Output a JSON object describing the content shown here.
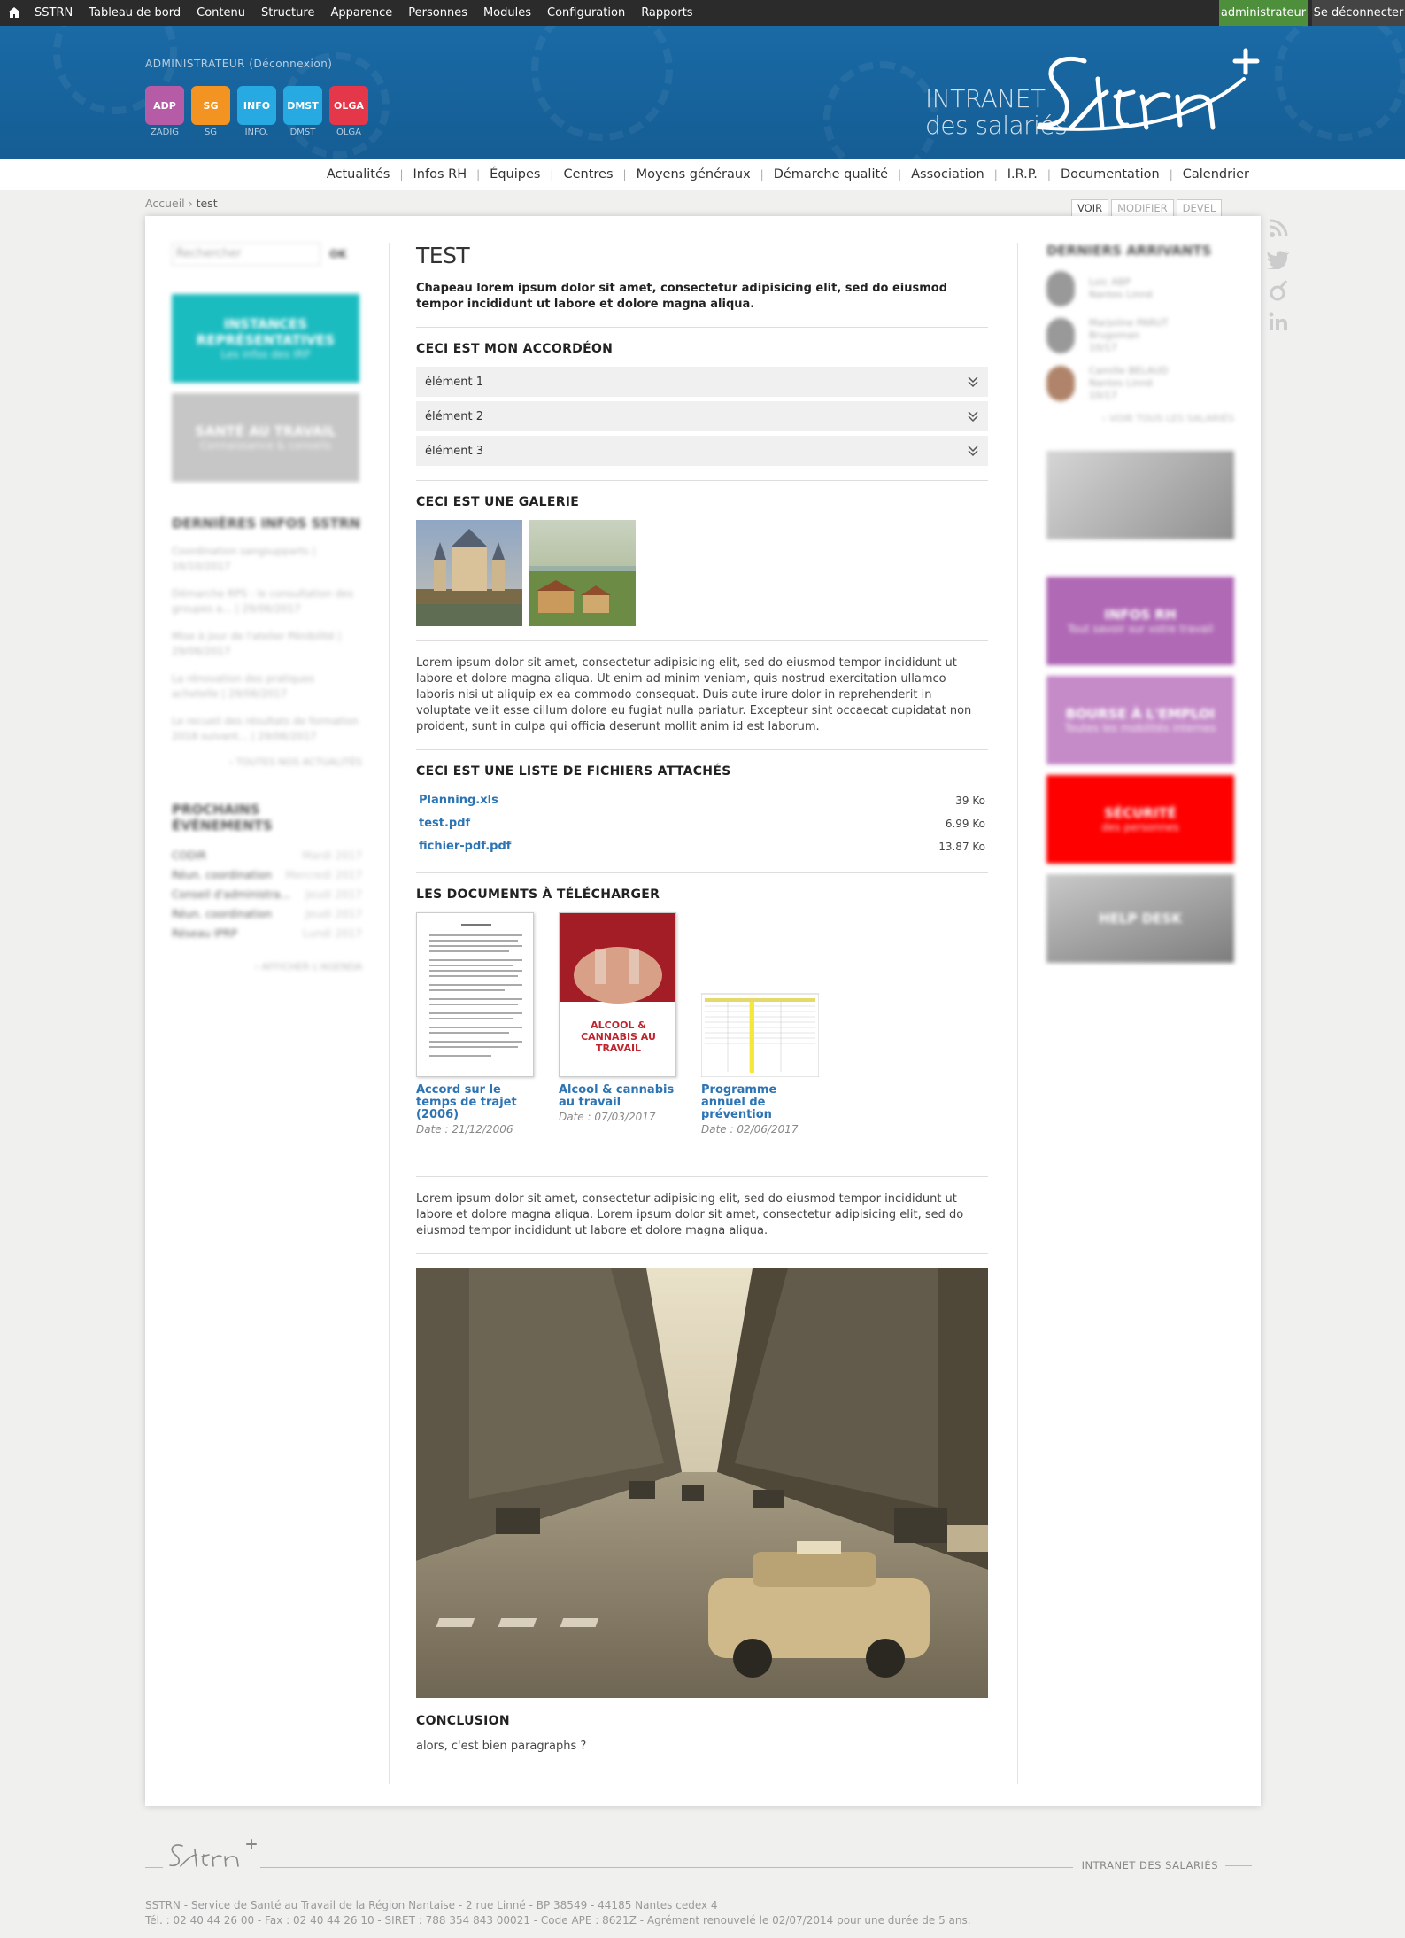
{
  "toolbar": {
    "menu": [
      "SSTRN",
      "Tableau de bord",
      "Contenu",
      "Structure",
      "Apparence",
      "Personnes",
      "Modules",
      "Configuration",
      "Rapports"
    ],
    "user": "administrateur",
    "logout": "Se déconnecter"
  },
  "banner": {
    "admin_label": "ADMINISTRATEUR",
    "admin_link": "(Déconnexion)",
    "apps": [
      {
        "label": "ZADIG",
        "tile": "ADP",
        "color": "#b65ca6"
      },
      {
        "label": "SG",
        "tile": "SG",
        "color": "#f39321"
      },
      {
        "label": "INFO.",
        "tile": "INFO",
        "color": "#27a9e1"
      },
      {
        "label": "DMST",
        "tile": "DMST",
        "color": "#27a9e1"
      },
      {
        "label": "OLGA",
        "tile": "OLGA",
        "color": "#e4384a"
      }
    ],
    "logo_line1": "INTRANET",
    "logo_line2": "des salariés",
    "logo_brand": "Sstrn"
  },
  "mainnav": [
    "Actualités",
    "Infos RH",
    "Équipes",
    "Centres",
    "Moyens généraux",
    "Démarche qualité",
    "Association",
    "I.R.P.",
    "Documentation",
    "Calendrier"
  ],
  "breadcrumb": {
    "home": "Accueil",
    "current": "test"
  },
  "view_tabs": [
    "VOIR",
    "MODIFIER",
    "DEVEL"
  ],
  "left": {
    "search_placeholder": "Rechercher",
    "search_ok": "OK",
    "blocks": [
      {
        "title": "INSTANCES REPRÉSENTATIVES",
        "sub": "Les infos des IRP",
        "color": "#1bbcc0"
      },
      {
        "title": "SANTÉ AU TRAVAIL",
        "sub": "Connaissance & conseils",
        "color": "#c6c6c6"
      }
    ],
    "news_title": "DERNIÈRES INFOS SSTRN",
    "news": [
      "Coordination sangsupparts | 16/10/2017",
      "Démarche RPS : le consultation des groupes a... | 29/06/2017",
      "Mise à jour de l'atelier Pénibilité | 29/06/2017",
      "La rénovation des pratiques achetelle | 29/06/2017",
      "Le recueil des résultats de formation 2018 suivant... | 29/06/2017"
    ],
    "news_more": "› TOUTES NOS ACTUALITÉS",
    "events_title": "PROCHAINS ÉVÉNEMENTS",
    "events": [
      {
        "name": "CODIR",
        "date": "Mardi 2017"
      },
      {
        "name": "Réun. coordination",
        "date": "Mercredi 2017"
      },
      {
        "name": "Conseil d'administra...",
        "date": "Jeudi 2017"
      },
      {
        "name": "Réun. coordination",
        "date": "Jeudi 2017"
      },
      {
        "name": "Réseau IPRP",
        "date": "Lundi 2017"
      }
    ],
    "events_more": "› AFFICHER L'AGENDA"
  },
  "content": {
    "title": "TEST",
    "chapeau": "Chapeau lorem ipsum dolor sit amet, consectetur adipisicing elit, sed do eiusmod tempor incididunt ut labore et dolore magna aliqua.",
    "accordion_title": "CECI EST MON ACCORDÉON",
    "accordion": [
      "élément 1",
      "élément 2",
      "élément 3"
    ],
    "gallery_title": "CECI EST UNE GALERIE",
    "lorem1": "Lorem ipsum dolor sit amet, consectetur adipisicing elit, sed do eiusmod tempor incididunt ut labore et dolore magna aliqua. Ut enim ad minim veniam, quis nostrud exercitation ullamco laboris nisi ut aliquip ex ea commodo consequat. Duis aute irure dolor in reprehenderit in voluptate velit esse cillum dolore eu fugiat nulla pariatur. Excepteur sint occaecat cupidatat non proident, sunt in culpa qui officia deserunt mollit anim id est laborum.",
    "files_title": "CECI EST UNE LISTE DE FICHIERS ATTACHÉS",
    "files": [
      {
        "name": "Planning.xls",
        "size": "39 Ko"
      },
      {
        "name": "test.pdf",
        "size": "6.99 Ko"
      },
      {
        "name": "fichier-pdf.pdf",
        "size": "13.87 Ko"
      }
    ],
    "docs_title": "LES DOCUMENTS À TÉLÉCHARGER",
    "docs": [
      {
        "title": "Accord sur le temps de trajet (2006)",
        "date": "Date : 21/12/2006"
      },
      {
        "title": "Alcool & cannabis au travail",
        "date": "Date : 07/03/2017",
        "cover_text": "ALCOOL & CANNABIS AU TRAVAIL"
      },
      {
        "title": "Programme annuel de prévention",
        "date": "Date : 02/06/2017"
      }
    ],
    "lorem2": "Lorem ipsum dolor sit amet, consectetur adipisicing elit, sed do eiusmod tempor incididunt ut labore et dolore magna aliqua. Lorem ipsum dolor sit amet, consectetur adipisicing elit, sed do eiusmod tempor incididunt ut labore et dolore magna aliqua.",
    "conclusion_title": "CONCLUSION",
    "conclusion_text": "alors, c'est bien paragraphs ?"
  },
  "right": {
    "arrivals_title": "DERNIERS ARRIVANTS",
    "arrivals": [
      {
        "name": "Loic ABP",
        "place": "Nantes Linné",
        "date": ""
      },
      {
        "name": "Marjoline PARUT",
        "place": "Brugoman",
        "date": "10/17"
      },
      {
        "name": "Camille BELAUD",
        "place": "Nantes Linné",
        "date": "10/17"
      }
    ],
    "arrivals_more": "› VOIR TOUS LES SALARIÉS",
    "blocks": [
      {
        "title": "INFOS RH",
        "sub": "Tout savoir sur votre travail",
        "color": "#b069b5"
      },
      {
        "title": "BOURSE À L'EMPLOI",
        "sub": "Toutes les mobilités internes",
        "color": "#c58ac8"
      },
      {
        "title": "SÉCURITÉ",
        "sub": "des personnes",
        "color": "#fe0000"
      },
      {
        "title": "HELP DESK",
        "sub": "",
        "color": "#999999"
      }
    ]
  },
  "footer": {
    "brand": "Sstrn",
    "tagline": "INTRANET DES SALARIÉS",
    "address1": "SSTRN - Service de Santé au Travail de la Région Nantaise - 2 rue Linné - BP 38549 - 44185 Nantes cedex 4",
    "address2": "Tél. : 02 40 44 26 00 - Fax : 02 40 44 26 10 - SIRET : 788 354 843 00021 - Code APE : 8621Z - Agrément renouvelé le 02/07/2014 pour une durée de 5 ans."
  }
}
